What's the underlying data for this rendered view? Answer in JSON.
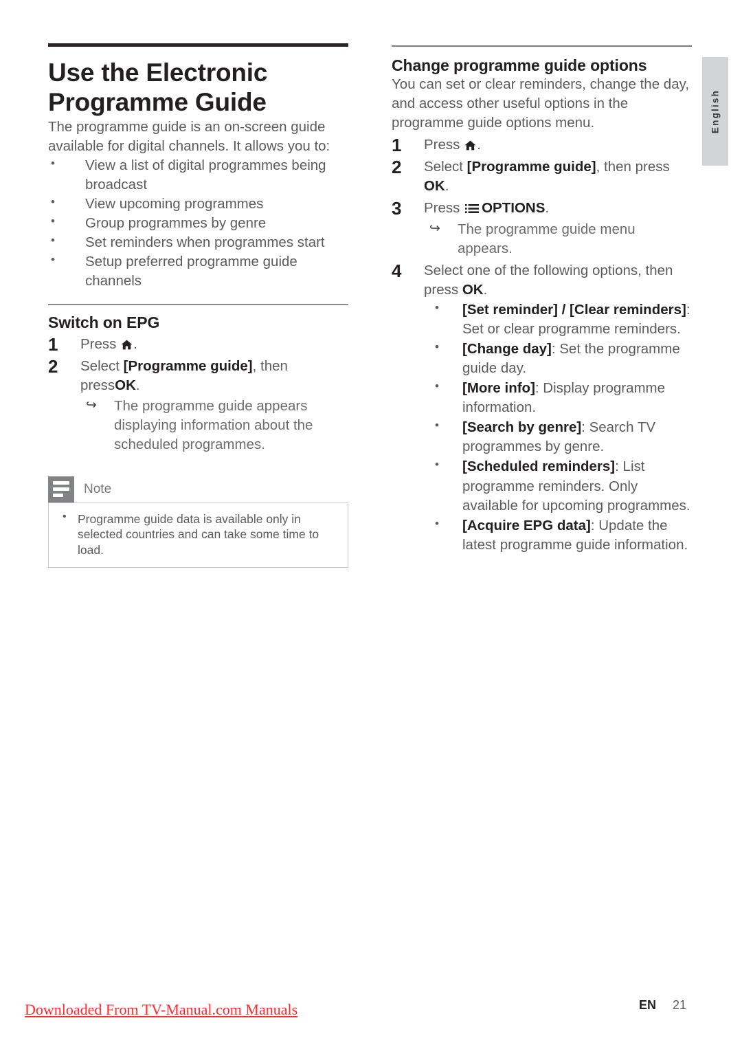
{
  "sidebar": {
    "language_tab": "English"
  },
  "left_column": {
    "title": "Use the Electronic Programme Guide",
    "intro": "The programme guide is an on-screen guide available for digital channels. It allows you to:",
    "features": [
      "View a list of digital programmes being broadcast",
      "View upcoming programmes",
      "Group programmes by genre",
      "Set reminders when programmes start",
      "Setup preferred programme guide channels"
    ],
    "section": {
      "heading": "Switch on EPG",
      "step1_prefix": "Press",
      "step1_suffix": ".",
      "step2_prefix": "Select ",
      "step2_menu": "[Programme guide]",
      "step2_mid": ", then press",
      "step2_ok": "OK",
      "step2_suffix": ".",
      "step2_result": "The programme guide appears displaying information about the scheduled programmes."
    },
    "note": {
      "title": "Note",
      "items": [
        "Programme guide data is available only in selected countries and can take some time to load."
      ]
    }
  },
  "right_column": {
    "heading": "Change programme guide options",
    "intro": "You can set or clear reminders, change the day, and access other useful options in the programme guide options menu.",
    "step1_prefix": "Press",
    "step1_suffix": ".",
    "step2_prefix": "Select ",
    "step2_menu": "[Programme guide]",
    "step2_mid": ", then press ",
    "step2_ok": "OK",
    "step2_suffix": ".",
    "step3_prefix": "Press ",
    "step3_options": "OPTIONS",
    "step3_suffix": ".",
    "step3_result": "The programme guide menu appears.",
    "step4_prefix": "Select one of the following options, then press ",
    "step4_ok": "OK",
    "step4_suffix": ".",
    "options": [
      {
        "label": "[Set reminder] / [Clear reminders]",
        "sep": ":",
        "desc": " Set or clear programme reminders."
      },
      {
        "label": "[Change day]",
        "sep": ":",
        "desc": " Set the programme guide day."
      },
      {
        "label": "[More info]",
        "sep": ":",
        "desc": " Display programme information."
      },
      {
        "label": "[Search by genre]",
        "sep": ":",
        "desc": " Search TV programmes by genre."
      },
      {
        "label": "[Scheduled reminders]",
        "sep": ":",
        "desc": " List programme reminders. Only available for upcoming programmes."
      },
      {
        "label": "[Acquire EPG data]",
        "sep": ":",
        "desc": " Update the latest programme guide information."
      }
    ]
  },
  "footer": {
    "download_link": "Downloaded From TV-Manual.com Manuals",
    "lang_code": "EN",
    "page_number": "21"
  },
  "colors": {
    "heading": "#231f20",
    "body": "#5c5c5e",
    "rule_dark": "#2b2322",
    "rule_light": "#7d7d80",
    "tab_bg": "#d2d4d6",
    "note_badge": "#808285",
    "footer_link": "#ff2a2a"
  }
}
